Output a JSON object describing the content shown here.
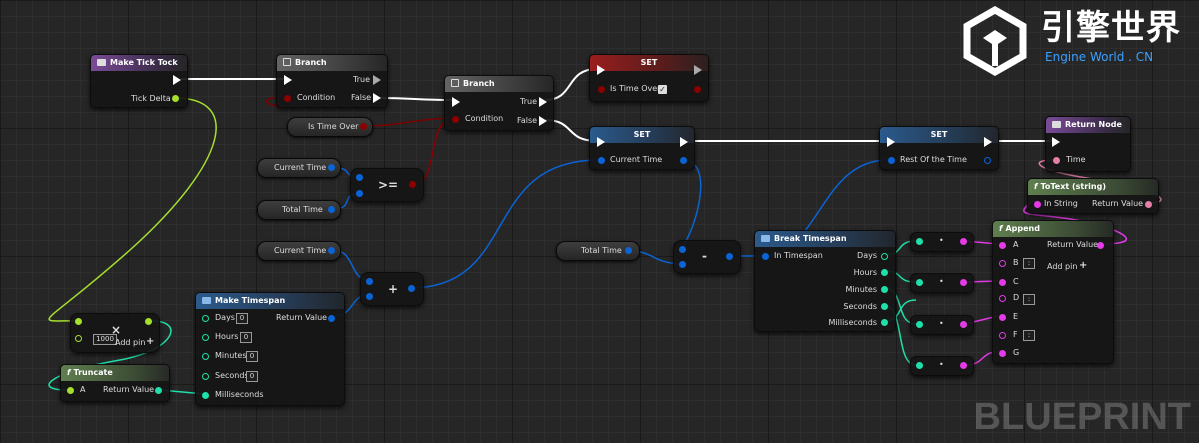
{
  "branding": {
    "logo_cn": "引擎世界",
    "logo_en": "Engine World . CN",
    "watermark": "BLUEPRINT"
  },
  "colors": {
    "exec": "#ffffff",
    "float": "#a6e02e",
    "bool": "#8c0000",
    "struct": "#0b64d6",
    "int": "#1fe0aa",
    "string": "#e43ae8",
    "text": "#e37fa9"
  },
  "nodes": {
    "make_tick_tock": {
      "title": "Make Tick Tock",
      "tick_delta": "Tick Delta"
    },
    "branch1": {
      "title": "Branch",
      "condition": "Condition",
      "true": "True",
      "false": "False"
    },
    "branch2": {
      "title": "Branch",
      "condition": "Condition",
      "true": "True",
      "false": "False"
    },
    "is_time_over_get": {
      "label": "Is Time Over"
    },
    "set_top": {
      "title": "SET",
      "label": "Is Time Over",
      "checked": "✓"
    },
    "set_mid": {
      "title": "SET",
      "label": "Current Time"
    },
    "set_right": {
      "title": "SET",
      "label": "Rest Of the Time"
    },
    "return_node": {
      "title": "Return Node",
      "time": "Time"
    },
    "totext": {
      "title": "ToText (string)",
      "in": "In String",
      "out": "Return Value"
    },
    "current_time_1": {
      "label": "Current Time"
    },
    "total_time_1": {
      "label": "Total Time"
    },
    "current_time_2": {
      "label": "Current Time"
    },
    "total_time_2": {
      "label": "Total Time"
    },
    "ge": {
      "op": ">="
    },
    "plus": {
      "op": "+"
    },
    "minus": {
      "op": "-"
    },
    "multiply": {
      "op": "×",
      "value": "1000",
      "add_pin": "Add pin"
    },
    "truncate": {
      "title": "Truncate",
      "a": "A",
      "out": "Return Value"
    },
    "make_timespan": {
      "title": "Make Timespan",
      "days": "Days",
      "hours": "Hours",
      "minutes": "Minutes",
      "seconds": "Seconds",
      "ms": "Milliseconds",
      "out": "Return Value",
      "zero": "0"
    },
    "break_timespan": {
      "title": "Break Timespan",
      "in": "In Timespan",
      "days": "Days",
      "hours": "Hours",
      "minutes": "Minutes",
      "seconds": "Seconds",
      "ms": "Milliseconds"
    },
    "append": {
      "title": "Append",
      "out": "Return Value",
      "add_pin": "Add pin",
      "a": "A",
      "b": "B",
      "c": "C",
      "d": "D",
      "e": "E",
      "f": "F",
      "g": "G",
      "colon": ":"
    },
    "conv": {
      "dot": "•"
    }
  }
}
